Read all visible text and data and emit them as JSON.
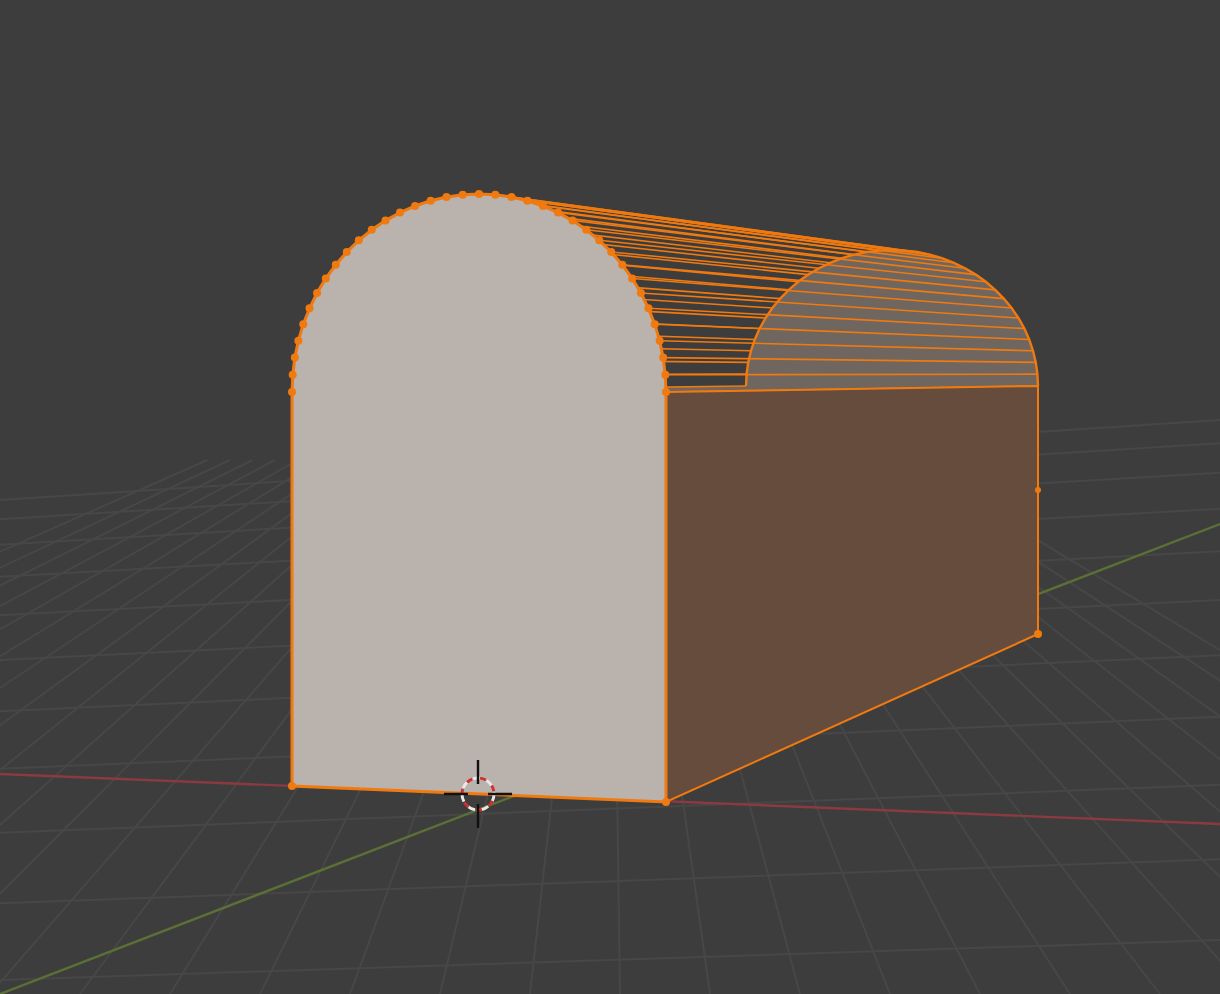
{
  "object": {
    "selected": true
  }
}
